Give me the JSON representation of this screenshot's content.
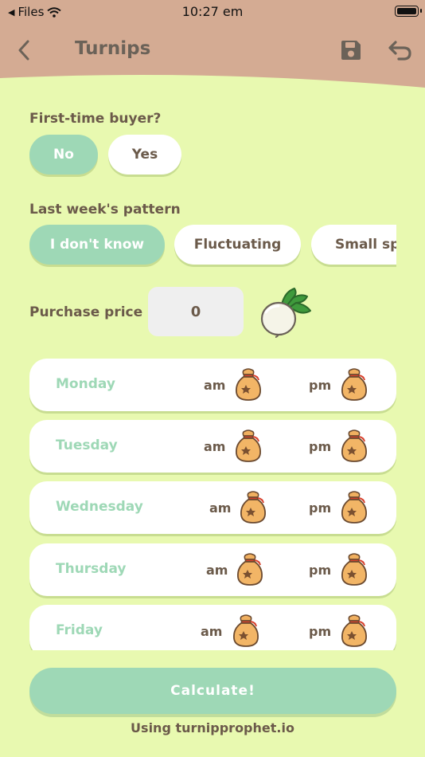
{
  "status_bar": {
    "carrier": "Files",
    "time": "10:27 em"
  },
  "header": {
    "title": "Turnips",
    "icons": [
      "back-icon",
      "save-icon",
      "undo-icon"
    ]
  },
  "first_time_buyer": {
    "label": "First-time buyer?",
    "options": [
      "No",
      "Yes"
    ],
    "selected": "No"
  },
  "pattern": {
    "label": "Last week's pattern",
    "options": [
      "I don't know",
      "Fluctuating",
      "Small spi"
    ],
    "selected": "I don't know"
  },
  "purchase": {
    "label": "Purchase price",
    "value": "0"
  },
  "days": [
    {
      "name": "Monday",
      "am": "am",
      "pm": "pm"
    },
    {
      "name": "Tuesday",
      "am": "am",
      "pm": "pm"
    },
    {
      "name": "Wednesday",
      "am": "am",
      "pm": "pm"
    },
    {
      "name": "Thursday",
      "am": "am",
      "pm": "pm"
    },
    {
      "name": "Friday",
      "am": "am",
      "pm": "pm"
    }
  ],
  "calculate_label": "Calculate!",
  "footer": "Using turnipprophet.io",
  "colors": {
    "header": "#d4ab93",
    "background": "#e8f9b0",
    "accent": "#9ed8b6",
    "text": "#6b5a4a"
  }
}
